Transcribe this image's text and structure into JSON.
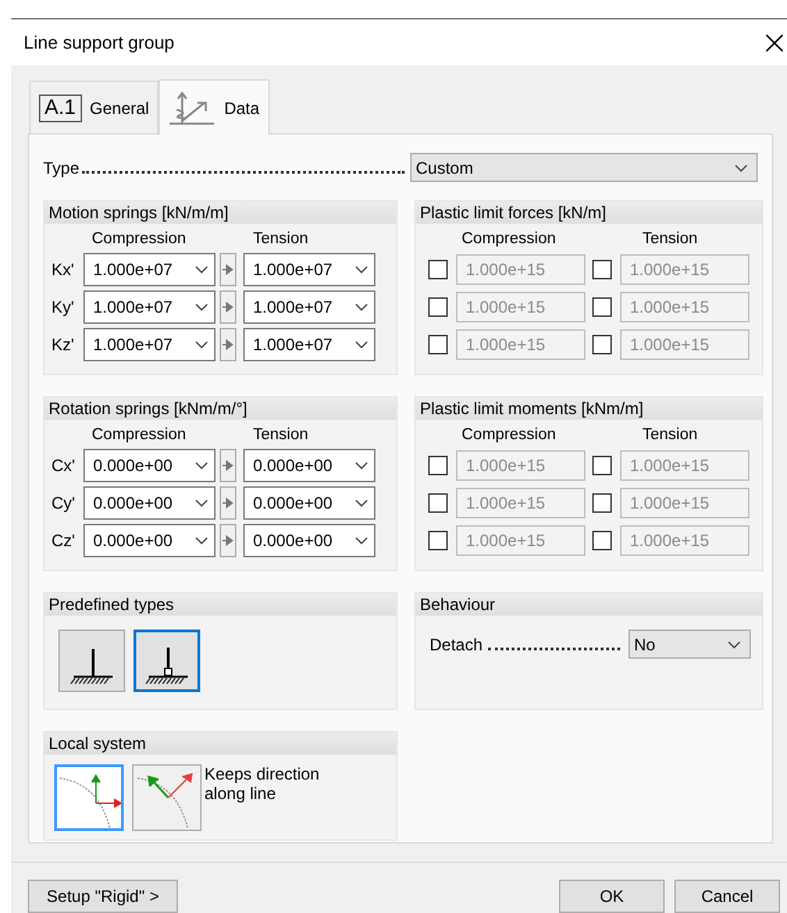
{
  "window": {
    "title": "Line support group"
  },
  "tabs": [
    {
      "kind": "general",
      "badge": "A.1",
      "label": "General",
      "selected": false
    },
    {
      "kind": "data",
      "label": "Data",
      "selected": true
    }
  ],
  "type_field": {
    "label": "Type",
    "value": "Custom"
  },
  "groups": [
    {
      "kind": "springs",
      "title": "Motion springs [kN/m/m]",
      "columns": [
        "Compression",
        "Tension"
      ],
      "rows": [
        {
          "label": "Kx'",
          "compression": "1.000e+07",
          "tension": "1.000e+07"
        },
        {
          "label": "Ky'",
          "compression": "1.000e+07",
          "tension": "1.000e+07"
        },
        {
          "label": "Kz'",
          "compression": "1.000e+07",
          "tension": "1.000e+07"
        }
      ]
    },
    {
      "kind": "plastic",
      "title": "Plastic limit forces [kN/m]",
      "columns": [
        "Compression",
        "Tension"
      ],
      "rows": [
        {
          "compression": {
            "value": "1.000e+15",
            "checked": false,
            "disabled": true
          },
          "tension": {
            "value": "1.000e+15",
            "checked": false,
            "disabled": true
          }
        },
        {
          "compression": {
            "value": "1.000e+15",
            "checked": false,
            "disabled": true
          },
          "tension": {
            "value": "1.000e+15",
            "checked": false,
            "disabled": true
          }
        },
        {
          "compression": {
            "value": "1.000e+15",
            "checked": false,
            "disabled": true
          },
          "tension": {
            "value": "1.000e+15",
            "checked": false,
            "disabled": true
          }
        }
      ]
    },
    {
      "kind": "springs",
      "title": "Rotation springs [kNm/m/°]",
      "columns": [
        "Compression",
        "Tension"
      ],
      "rows": [
        {
          "label": "Cx'",
          "compression": "0.000e+00",
          "tension": "0.000e+00"
        },
        {
          "label": "Cy'",
          "compression": "0.000e+00",
          "tension": "0.000e+00"
        },
        {
          "label": "Cz'",
          "compression": "0.000e+00",
          "tension": "0.000e+00"
        }
      ]
    },
    {
      "kind": "plastic",
      "title": "Plastic limit moments [kNm/m]",
      "columns": [
        "Compression",
        "Tension"
      ],
      "rows": [
        {
          "compression": {
            "value": "1.000e+15",
            "checked": false,
            "disabled": true
          },
          "tension": {
            "value": "1.000e+15",
            "checked": false,
            "disabled": true
          }
        },
        {
          "compression": {
            "value": "1.000e+15",
            "checked": false,
            "disabled": true
          },
          "tension": {
            "value": "1.000e+15",
            "checked": false,
            "disabled": true
          }
        },
        {
          "compression": {
            "value": "1.000e+15",
            "checked": false,
            "disabled": true
          },
          "tension": {
            "value": "1.000e+15",
            "checked": false,
            "disabled": true
          }
        }
      ]
    },
    {
      "kind": "predefined",
      "title": "Predefined types",
      "items": [
        {
          "kind": "fixed",
          "selected": false
        },
        {
          "kind": "hinged",
          "selected": true
        }
      ]
    },
    {
      "kind": "behaviour",
      "title": "Behaviour",
      "label": "Detach",
      "value": "No"
    },
    {
      "kind": "local",
      "title": "Local system",
      "options": [
        {
          "kind": "fixed-axes",
          "selected": true
        },
        {
          "kind": "along-line",
          "selected": false
        }
      ],
      "description": "Keeps direction along line"
    }
  ],
  "buttons": [
    {
      "kind": "setup",
      "label": "Setup \"Rigid\" >"
    },
    {
      "kind": "ok",
      "label": "OK"
    },
    {
      "kind": "cancel",
      "label": "Cancel"
    }
  ]
}
